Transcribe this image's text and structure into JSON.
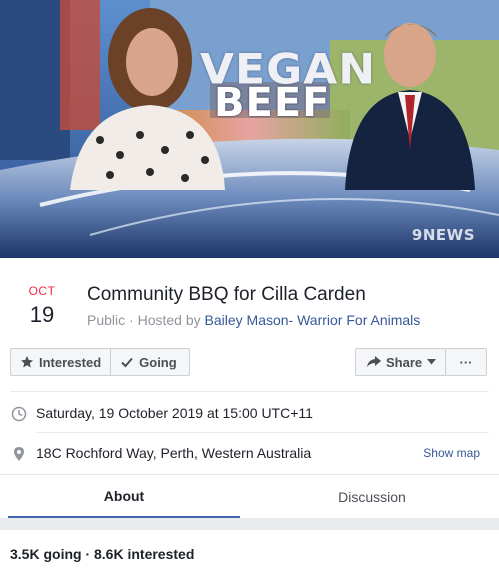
{
  "cover": {
    "headline_line1": "VEGAN",
    "headline_line2": "BEEF",
    "channel_logo": "9NEWS"
  },
  "event": {
    "month": "OCT",
    "day": "19",
    "title": "Community BBQ for Cilla Carden",
    "privacy": "Public",
    "hosted_by_prefix": " · Hosted by ",
    "host": "Bailey Mason- Warrior For Animals"
  },
  "actions": {
    "interested": "Interested",
    "going": "Going",
    "share": "Share",
    "more": "···"
  },
  "details": {
    "datetime": "Saturday, 19 October 2019 at 15:00 UTC+11",
    "location": "18C Rochford Way, Perth, Western Australia",
    "show_map": "Show map"
  },
  "tabs": [
    {
      "label": "About",
      "active": true
    },
    {
      "label": "Discussion",
      "active": false
    }
  ],
  "stats": "3.5K going · 8.6K interested",
  "colors": {
    "accent": "#4267b2",
    "link": "#365899",
    "month_red": "#f02849"
  }
}
